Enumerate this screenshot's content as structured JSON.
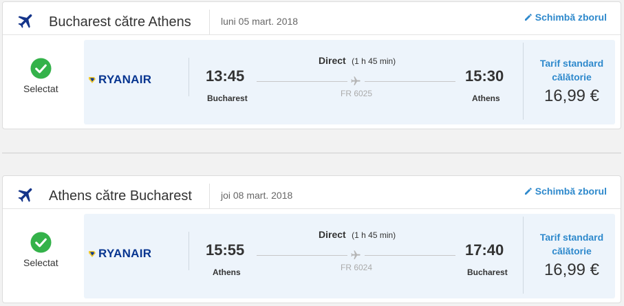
{
  "colors": {
    "accent": "#2e89cc",
    "plane_icon": "#14348a",
    "check_green": "#34b24a",
    "box_bg": "#edf4fb",
    "ryanair_blue": "#073590",
    "ryanair_harp": "#f1c933"
  },
  "flights": [
    {
      "route_title": "Bucharest către Athens",
      "date": "luni 05 mart. 2018",
      "change_label": "Schimbă zborul",
      "selected_label": "Selectat",
      "airline": "RYANAIR",
      "departure_time": "13:45",
      "departure_city": "Bucharest",
      "arrival_time": "15:30",
      "arrival_city": "Athens",
      "direct_label": "Direct",
      "duration": "(1 h 45 min)",
      "flight_number": "FR 6025",
      "fare_label": "Tarif standard călătorie",
      "price": "16,99 €"
    },
    {
      "route_title": "Athens către Bucharest",
      "date": "joi 08 mart. 2018",
      "change_label": "Schimbă zborul",
      "selected_label": "Selectat",
      "airline": "RYANAIR",
      "departure_time": "15:55",
      "departure_city": "Athens",
      "arrival_time": "17:40",
      "arrival_city": "Bucharest",
      "direct_label": "Direct",
      "duration": "(1 h 45 min)",
      "flight_number": "FR 6024",
      "fare_label": "Tarif standard călătorie",
      "price": "16,99 €"
    }
  ]
}
